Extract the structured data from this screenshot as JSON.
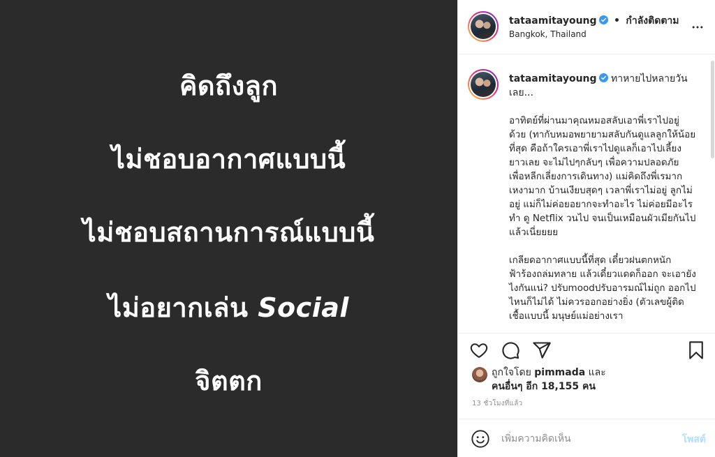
{
  "post_image": {
    "lines": [
      "คิดถึงลูก",
      "ไม่ชอบอากาศแบบนี้",
      "ไม่ชอบสถานการณ์แบบนี้",
      "ไม่อยากเล่น",
      "จิตตก"
    ],
    "social_word": "Social"
  },
  "header": {
    "username": "tataamitayoung",
    "follow_separator": "•",
    "follow_status": "กำลังติดตาม",
    "location": "Bangkok, Thailand"
  },
  "caption": {
    "username": "tataamitayoung",
    "headline": "ทาหายไปหลายวันเลย...",
    "paragraph_1": "อาทิตย์ที่ผ่านมาคุณหมอสลับเอาพี่เราไปอยู่ด้วย (ทากับหมอพยายามสลับกันดูแลลูกให้น้อยที่สุด คือถ้าใครเอาพี่เราไปดูแลก็เอาไปเลี้ยงยาวเลย จะไม่ไปๆกลับๆ เพื่อความปลอดภัย เพื่อหลีกเลี่ยงการเดินทาง) แม่คิดถึงพี่เรมาก เหงามาก บ้านเงียบสุดๆ เวลาพี่เราไม่อยู่ ลูกไม่อยู่ แม่ก็ไม่ค่อยอยากจะทำอะไร ไม่ค่อยมีอะไรทำ ดู Netflix วนไป จนเป็นเหมือนผัวเมียกันไปแล้วเนี่ยยยย",
    "paragraph_2": "เกลียดอากาศแบบนี้ที่สุด เดี๋ยวฝนตกหนักฟ้าร้องถล่มทลาย แล้วเดี๋ยวแดดก็ออก จะเอายังไงกันแน่? ปรับmoodปรับอารมณ์ไม่ถูก ออกไปไหนก็ไม่ได้ ไม่ควรออกอย่างยิ่ง (ตัวเลขผู้ติดเชื้อแบบนี้ มนุษย์แม่อย่างเรา"
  },
  "likes": {
    "prefix": "ถูกใจโดย",
    "liker": "pimmada",
    "conjunction": "และ",
    "others": "คนอื่นๆ อีก 18,155 คน"
  },
  "timestamp": "13 ชั่วโมงที่แล้ว",
  "comment": {
    "placeholder": "เพิ่มความคิดเห็น",
    "post_label": "โพสต์"
  },
  "colors": {
    "image_bg": "#2b2b2b",
    "verified_blue": "#3897f0",
    "post_button_disabled": "#b2dffc"
  },
  "icons": [
    "more-options-icon",
    "verified-badge-icon",
    "heart-icon",
    "comment-icon",
    "share-icon",
    "bookmark-icon",
    "emoji-icon"
  ]
}
